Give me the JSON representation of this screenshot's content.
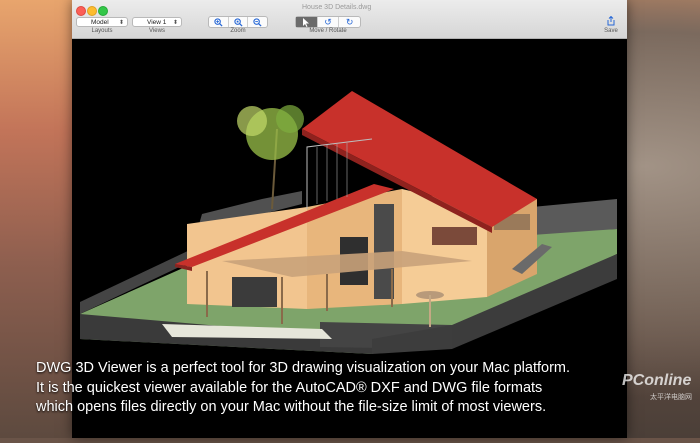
{
  "window": {
    "title": "House 3D Details.dwg"
  },
  "toolbar": {
    "layouts": {
      "value": "Model",
      "label": "Layouts"
    },
    "views": {
      "value": "View 1",
      "label": "Views"
    },
    "zoom": {
      "label": "Zoom"
    },
    "move_rotate": {
      "label": "Move / Rotate"
    },
    "save": {
      "label": "Save"
    }
  },
  "caption": {
    "line1": "DWG 3D Viewer is a perfect tool for 3D drawing visualization on your Mac platform.",
    "line2": "It is the quickest viewer available for the AutoCAD® DXF and DWG file formats",
    "line3": "which opens files directly on your Mac without the file-size limit of most viewers."
  },
  "watermark": {
    "brand": "PConline",
    "sub": "太平洋电脑网"
  },
  "colors": {
    "roof": "#c8312b",
    "wall": "#f2c58f",
    "ground": "#8fb27a",
    "accent": "#2667d6"
  }
}
